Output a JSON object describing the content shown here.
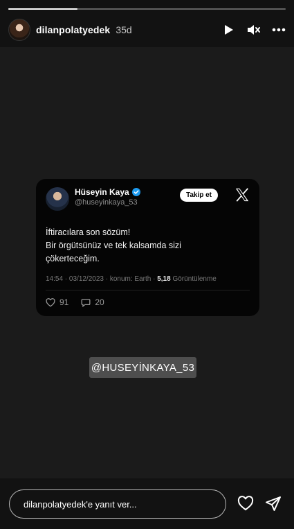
{
  "story": {
    "progress_fraction": 0.25,
    "username": "dilanpolatyedek",
    "age": "35d",
    "controls": [
      "play-icon",
      "mute-icon",
      "more-icon"
    ]
  },
  "tweet": {
    "name": "Hüseyin Kaya",
    "handle": "@huseyinkaya_53",
    "follow_label": "Takip et",
    "text_lines": [
      "İftiracılara son sözüm!",
      "Bir örgütsünüz ve tek kalsamda sizi",
      "çökerteceğim."
    ],
    "meta_prefix": "14:54 · 03/12/2023 · konum: Earth · ",
    "views_count": "5,18",
    "views_label": " Görüntülenme",
    "likes": "91",
    "replies": "20",
    "verified_color": "#1d9bf0"
  },
  "mention": {
    "text": "@HUSEYİNKAYA_53"
  },
  "reply": {
    "placeholder": "dilanpolatyedek'e yanıt ver..."
  }
}
